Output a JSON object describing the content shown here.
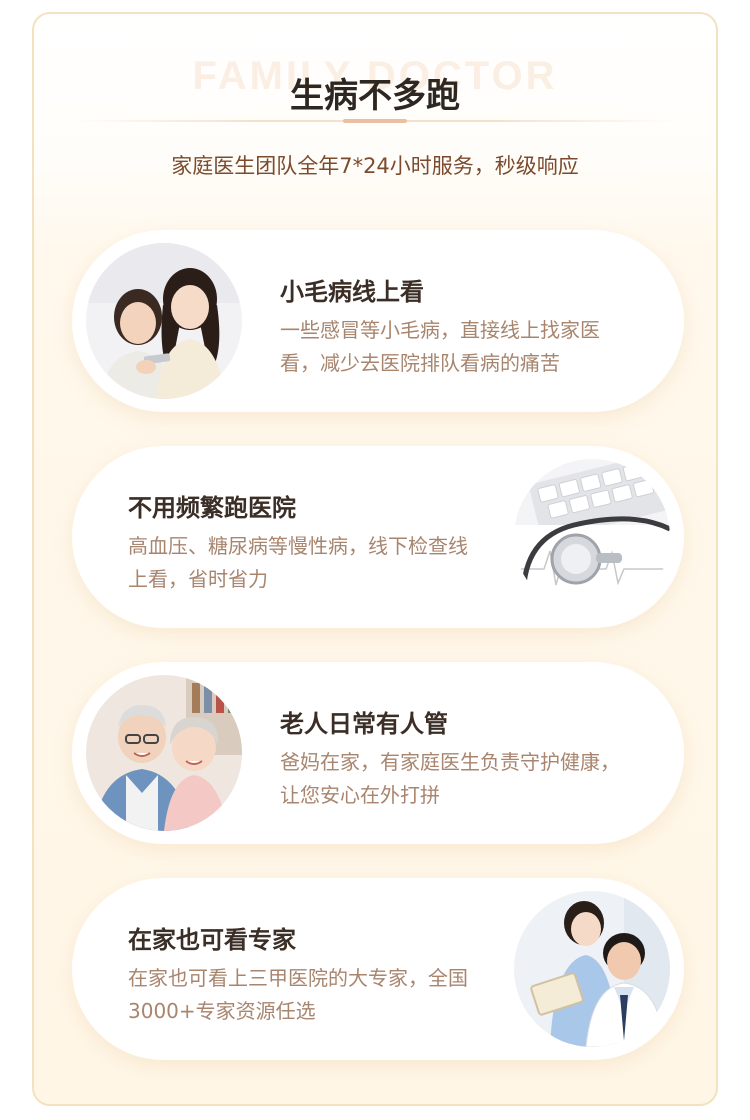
{
  "header": {
    "watermark": "FAMILY DOCTOR",
    "title": "生病不多跑",
    "subtitle": "家庭医生团队全年7*24小时服务，秒级响应"
  },
  "cards": [
    {
      "title": "小毛病线上看",
      "description": "一些感冒等小毛病，直接线上找家医看，减少去医院排队看病的痛苦",
      "image": "mother-daughter-phone-photo"
    },
    {
      "title": "不用频繁跑医院",
      "description": "高血压、糖尿病等慢性病，线下检查线上看，省时省力",
      "image": "stethoscope-keyboard-photo"
    },
    {
      "title": "老人日常有人管",
      "description": "爸妈在家，有家庭医生负责守护健康，让您安心在外打拼",
      "image": "elderly-couple-photo"
    },
    {
      "title": "在家也可看专家",
      "description": "在家也可看上三甲医院的大专家，全国3000+专家资源任选",
      "image": "doctors-consulting-photo"
    }
  ],
  "colors": {
    "frame_border": "#f3e2bf",
    "title": "#2e2621",
    "subtitle": "#7c4a2c",
    "card_title": "#3b2e26",
    "card_desc": "#a8856e",
    "accent": "#e9c0a2"
  }
}
